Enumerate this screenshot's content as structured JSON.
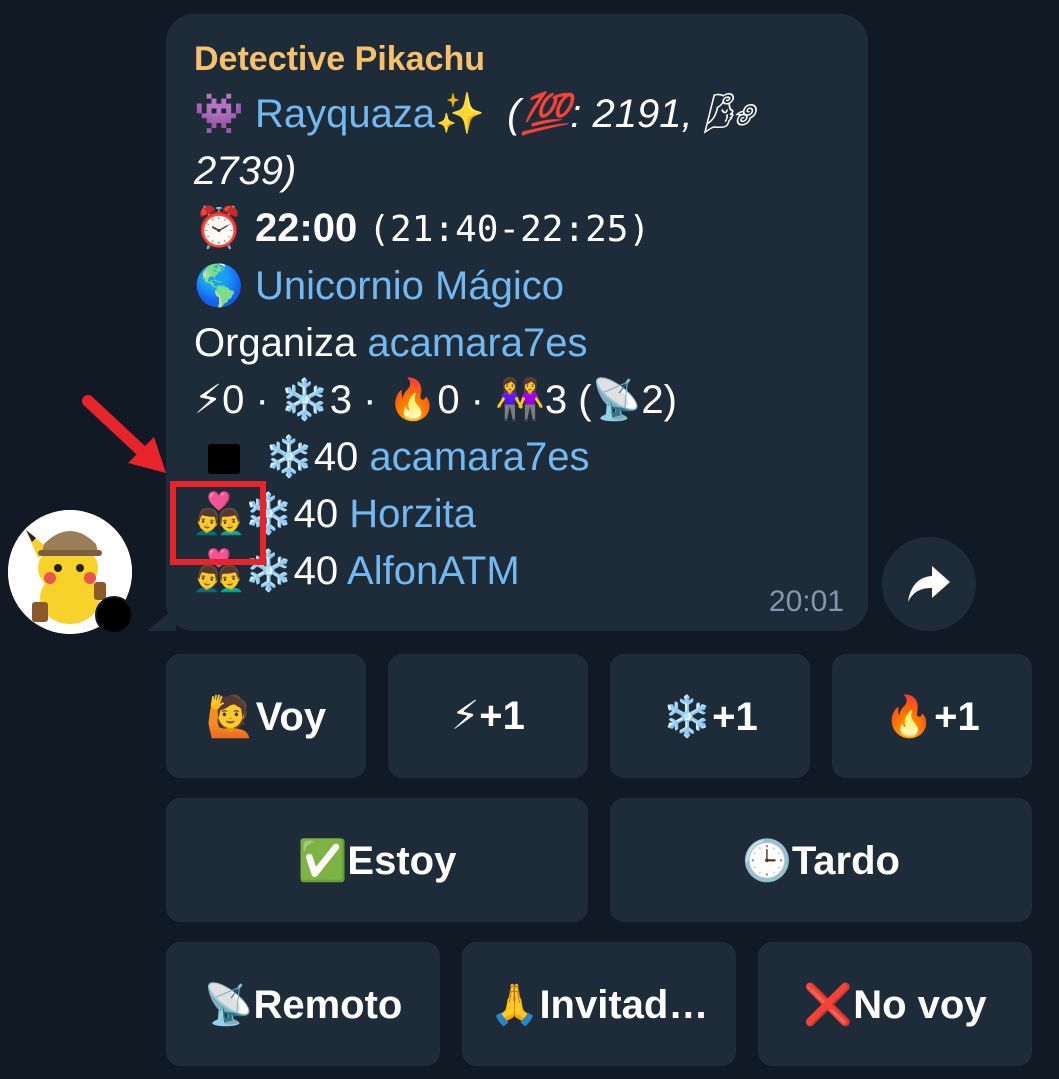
{
  "message": {
    "sender": "Detective Pikachu",
    "boss_emoji": "👾",
    "boss_name": "Rayquaza✨",
    "cp_open": "(",
    "cp_emoji": "💯",
    "cp_text": ": 2191, ",
    "wind_emoji": "🌬",
    "cp_weather": "2739)",
    "alarm_emoji": "⏰",
    "time": "22:00",
    "time_range": "(21:40-22:25)",
    "globe_emoji": "🌎",
    "location": "Unicornio Mágico",
    "organizer_label": "Organiza ",
    "organizer": "acamara7es",
    "counts": {
      "bolt": "⚡",
      "bolt_count": "0 · ",
      "snow": "❄️",
      "snow_count": "3 · ",
      "fire": "🔥",
      "fire_count": "0 · ",
      "people": "👭",
      "people_count": "3 (",
      "remote": "📡",
      "remote_count": "2)"
    },
    "attendees": [
      {
        "icon": "",
        "team": "❄️",
        "level": "40 ",
        "name": "acamara7es"
      },
      {
        "icon": "👨‍❤️‍👨",
        "team": "❄️",
        "level": "40 ",
        "name": "Horzita"
      },
      {
        "icon": "👨‍❤️‍👨",
        "team": "❄️",
        "level": "40 ",
        "name": "AlfonATM"
      }
    ],
    "timestamp": "20:01"
  },
  "buttons": {
    "voy": "🙋Voy",
    "bolt_plus": "⚡+1",
    "snow_plus": "❄️+1",
    "fire_plus": "🔥+1",
    "estoy": "✅Estoy",
    "tardo": "🕒Tardo",
    "remoto": "📡Remoto",
    "invitado": "🙏Invitad…",
    "no_voy": "❌No voy"
  },
  "colors": {
    "background": "#111a24",
    "bubble": "#1e2c3a",
    "link": "#72b8f1",
    "sender": "#f7c06a",
    "annotation": "#e8232a"
  }
}
